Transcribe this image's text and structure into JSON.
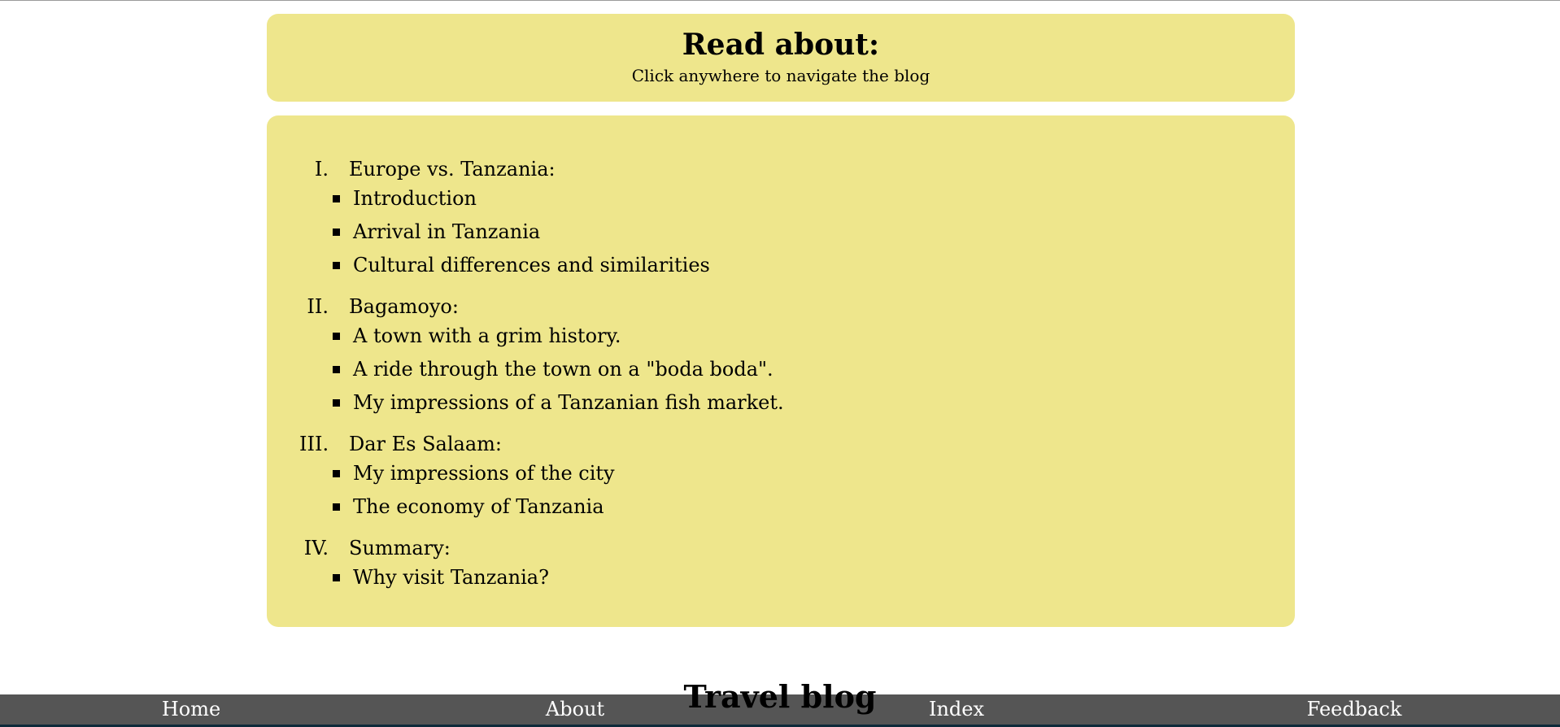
{
  "header": {
    "title": "Read about:",
    "subtitle": "Click anywhere to navigate the blog"
  },
  "toc": [
    {
      "numeral": "I.",
      "label": "Europe vs. Tanzania:",
      "items": [
        "Introduction",
        "Arrival in Tanzania",
        "Cultural differences and similarities"
      ]
    },
    {
      "numeral": "II.",
      "label": "Bagamoyo:",
      "items": [
        "A town with a grim history.",
        "A ride through the town on a \"boda boda\".",
        "My impressions of a Tanzanian fish market."
      ]
    },
    {
      "numeral": "III.",
      "label": "Dar Es Salaam:",
      "items": [
        "My impressions of the city",
        "The economy of Tanzania"
      ]
    },
    {
      "numeral": "IV.",
      "label": "Summary:",
      "items": [
        "Why visit Tanzania?"
      ]
    }
  ],
  "site_title": "Travel blog",
  "nav": {
    "home": "Home",
    "about": "About",
    "index": "Index",
    "feedback": "Feedback"
  },
  "colors": {
    "panel": "#eee68c",
    "navbar": "#555555",
    "nav_text": "#ffffff"
  }
}
